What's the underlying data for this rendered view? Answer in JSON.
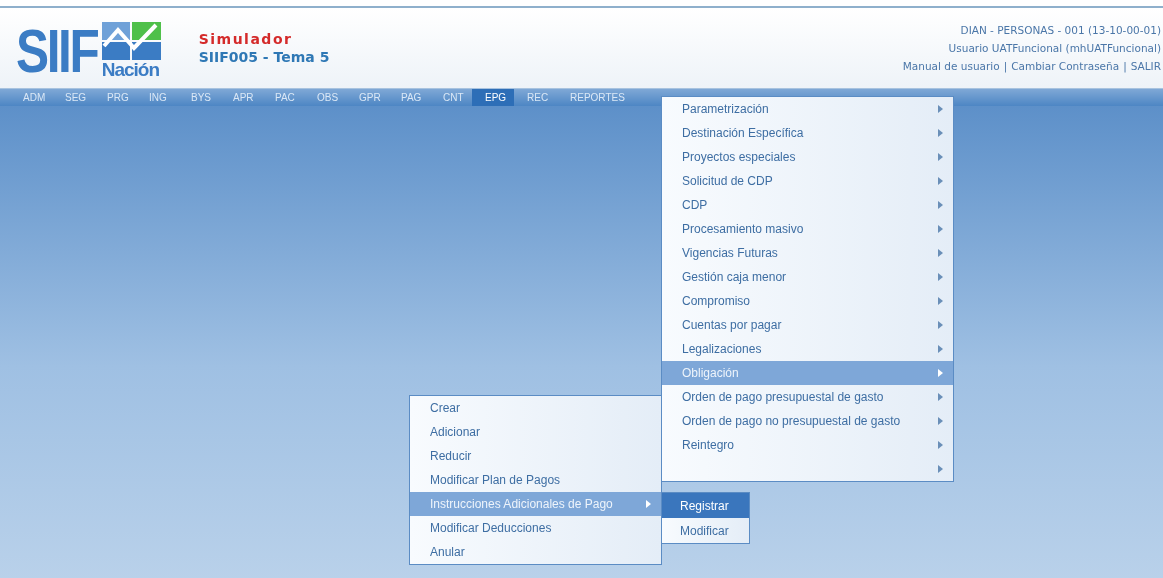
{
  "logo": {
    "title": "SIIF",
    "subtitle": "Nación"
  },
  "app": {
    "name": "Simulador",
    "module": "SIIF005 - Tema 5"
  },
  "user_info": {
    "entity": "DIAN - PERSONAS - 001 (13-10-00-01)",
    "user": "Usuario UATFuncional (mhUATFuncional)",
    "links": [
      "Manual de usuario",
      "Cambiar Contraseña",
      "SALIR"
    ],
    "separator": "|"
  },
  "nav": [
    {
      "label": "ADM",
      "selected": false
    },
    {
      "label": "SEG",
      "selected": false
    },
    {
      "label": "PRG",
      "selected": false
    },
    {
      "label": "ING",
      "selected": false
    },
    {
      "label": "BYS",
      "selected": false
    },
    {
      "label": "APR",
      "selected": false
    },
    {
      "label": "PAC",
      "selected": false
    },
    {
      "label": "OBS",
      "selected": false
    },
    {
      "label": "GPR",
      "selected": false
    },
    {
      "label": "PAG",
      "selected": false
    },
    {
      "label": "CNT",
      "selected": false
    },
    {
      "label": "EPG",
      "selected": true
    },
    {
      "label": "REC",
      "selected": false
    },
    {
      "label": "REPORTES",
      "selected": false
    }
  ],
  "menu": [
    {
      "label": "Parametrización",
      "selected": false
    },
    {
      "label": "Destinación Específica",
      "selected": false
    },
    {
      "label": "Proyectos especiales",
      "selected": false
    },
    {
      "label": "Solicitud de CDP",
      "selected": false
    },
    {
      "label": "CDP",
      "selected": false
    },
    {
      "label": "Procesamiento masivo",
      "selected": false
    },
    {
      "label": "Vigencias Futuras",
      "selected": false
    },
    {
      "label": "Gestión caja menor",
      "selected": false
    },
    {
      "label": "Compromiso",
      "selected": false
    },
    {
      "label": "Cuentas por pagar",
      "selected": false
    },
    {
      "label": "Legalizaciones",
      "selected": false
    },
    {
      "label": "Obligación",
      "selected": true
    },
    {
      "label": "Orden de pago presupuestal de gasto",
      "selected": false
    },
    {
      "label": "Orden de pago no presupuestal de gasto",
      "selected": false
    },
    {
      "label": "Reintegro",
      "selected": false
    },
    {
      "selected": false
    }
  ],
  "submenu": [
    {
      "label": "Crear",
      "selected": false,
      "has_submenu": false
    },
    {
      "label": "Adicionar",
      "selected": false,
      "has_submenu": false
    },
    {
      "label": "Reducir",
      "selected": false,
      "has_submenu": false
    },
    {
      "label": "Modificar Plan de Pagos",
      "selected": false,
      "has_submenu": false
    },
    {
      "label": "Instrucciones Adicionales de Pago",
      "selected": true,
      "has_submenu": true
    },
    {
      "label": "Modificar Deducciones",
      "selected": false,
      "has_submenu": false
    },
    {
      "label": "Anular",
      "selected": false,
      "has_submenu": false
    }
  ],
  "submenu2": [
    {
      "label": "Registrar",
      "selected": true
    },
    {
      "label": "Modificar",
      "selected": false
    }
  ]
}
